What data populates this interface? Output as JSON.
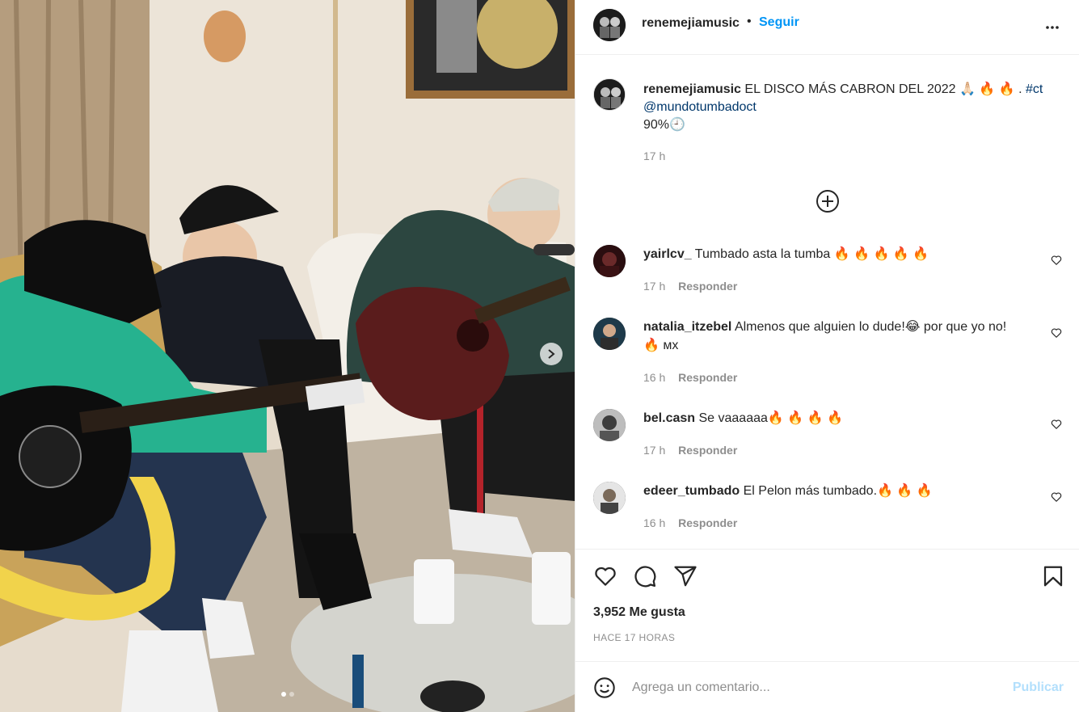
{
  "post": {
    "username": "renemejiamusic",
    "separator": "•",
    "follow_label": "Seguir",
    "more_icon": "more-horizontal-icon"
  },
  "caption": {
    "username": "renemejiamusic",
    "text": "EL DISCO MÁS CABRON DEL 2022 🙏🏻 🔥 🔥 .",
    "hashtag": "#ct",
    "mention": "@mundotumbadoct",
    "line3": "90%🕘",
    "time": "17 h"
  },
  "load_more_icon": "plus-circle-icon",
  "comments": [
    {
      "username": "yairlcv_",
      "text": "Tumbado asta la tumba 🔥 🔥 🔥 🔥 🔥",
      "time": "17 h",
      "reply": "Responder"
    },
    {
      "username": "natalia_itzebel",
      "text": "Almenos que alguien lo dude!😂  por que yo no! 🔥 ᴍх",
      "time": "16 h",
      "reply": "Responder"
    },
    {
      "username": "bel.casn",
      "text": "Se vaaaaaa🔥 🔥 🔥 🔥",
      "time": "17 h",
      "reply": "Responder"
    },
    {
      "username": "edeer_tumbado",
      "text": "El Pelon más tumbado.🔥 🔥 🔥",
      "time": "16 h",
      "reply": "Responder"
    }
  ],
  "actions": {
    "likes": "3,952 Me gusta",
    "ago": "HACE 17 HORAS"
  },
  "add_comment": {
    "placeholder": "Agrega un comentario...",
    "publish_label": "Publicar"
  },
  "carousel": {
    "total": 2,
    "current": 1
  },
  "colors": {
    "accent": "#0095f6",
    "publish_disabled": "#b2dffc",
    "secondary_text": "#8e8e8e"
  }
}
